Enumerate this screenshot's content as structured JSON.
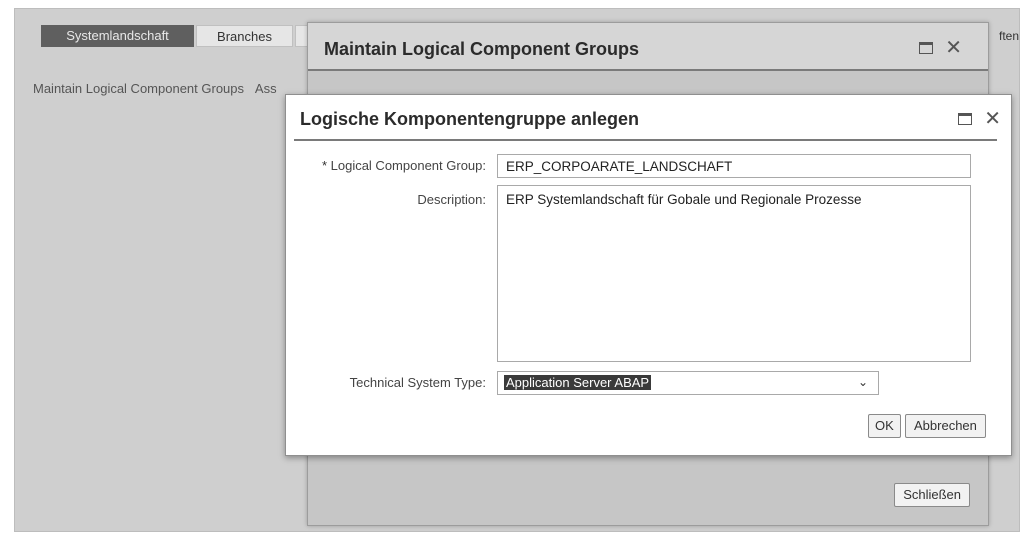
{
  "app": {
    "tabs": [
      {
        "label": "Systemlandschaft"
      },
      {
        "label": "Branches"
      }
    ],
    "right_partial_tab": "ften",
    "subnav": {
      "item1": "Maintain Logical Component Groups",
      "item2": "Ass"
    }
  },
  "outer_dialog": {
    "title": "Maintain Logical Component Groups",
    "close_button_label": "Schließen"
  },
  "inner_dialog": {
    "title": "Logische Komponentengruppe anlegen",
    "fields": {
      "group": {
        "required_mark": "*",
        "label": "Logical Component Group:",
        "value": "ERP_CORPOARATE_LANDSCHAFT"
      },
      "description": {
        "label": "Description:",
        "value": "ERP Systemlandschaft für Gobale und Regionale Prozesse"
      },
      "system_type": {
        "label": "Technical System Type:",
        "value": "Application Server ABAP"
      }
    },
    "buttons": {
      "ok": "OK",
      "cancel": "Abbrechen"
    }
  },
  "icons": {
    "maximize": "maximize-icon",
    "close": "close-icon",
    "dropdown": "chevron-down-icon"
  },
  "colors": {
    "active_tab": "#5f5f5f",
    "backdrop": "#cfcfcf",
    "selection": "#3a3a3a"
  }
}
